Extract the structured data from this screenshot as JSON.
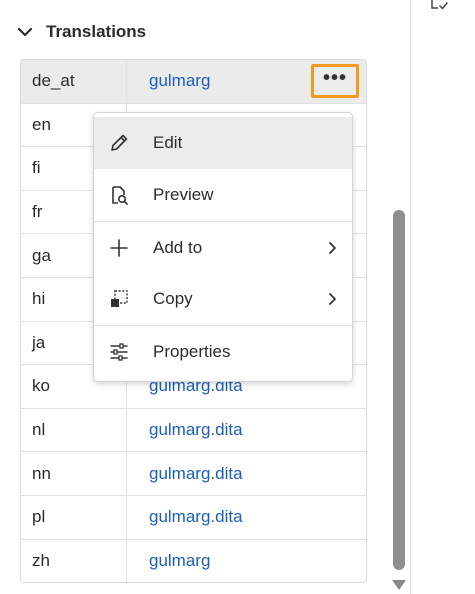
{
  "section": {
    "title": "Translations"
  },
  "table": {
    "rows": [
      {
        "lang": "de_at",
        "file": "gulmarg"
      },
      {
        "lang": "en",
        "file": ""
      },
      {
        "lang": "fi",
        "file": ""
      },
      {
        "lang": "fr",
        "file": ""
      },
      {
        "lang": "ga",
        "file": ""
      },
      {
        "lang": "hi",
        "file": ""
      },
      {
        "lang": "ja",
        "file": ""
      },
      {
        "lang": "ko",
        "file": "gulmarg.dita"
      },
      {
        "lang": "nl",
        "file": "gulmarg.dita"
      },
      {
        "lang": "nn",
        "file": "gulmarg.dita"
      },
      {
        "lang": "pl",
        "file": "gulmarg.dita"
      },
      {
        "lang": "zh",
        "file": "gulmarg"
      }
    ]
  },
  "menu": {
    "items": [
      {
        "label": "Edit",
        "icon": "pencil-icon"
      },
      {
        "label": "Preview",
        "icon": "preview-icon"
      },
      {
        "label": "Add to",
        "icon": "plus-icon"
      },
      {
        "label": "Copy",
        "icon": "copy-icon"
      },
      {
        "label": "Properties",
        "icon": "sliders-icon"
      }
    ]
  },
  "colors": {
    "link": "#1b5fb7",
    "highlight": "#f39a1e"
  }
}
